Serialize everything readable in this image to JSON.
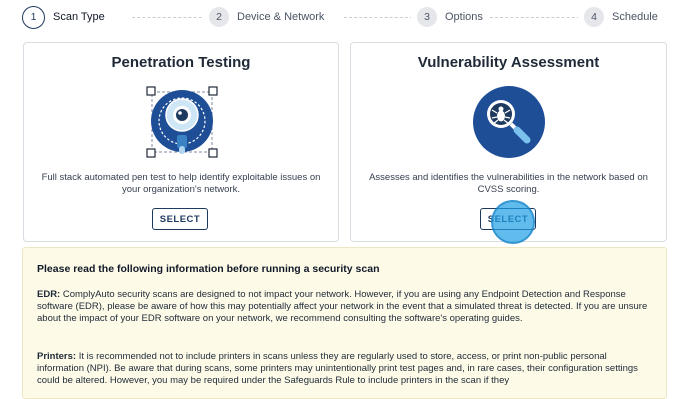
{
  "stepper": {
    "steps": [
      {
        "number": "1",
        "label": "Scan Type",
        "active": true
      },
      {
        "number": "2",
        "label": "Device & Network",
        "active": false
      },
      {
        "number": "3",
        "label": "Options",
        "active": false
      },
      {
        "number": "4",
        "label": "Schedule",
        "active": false
      }
    ]
  },
  "cards": [
    {
      "title": "Penetration Testing",
      "description": "Full stack automated pen test to help identify exploitable issues on your organization's network.",
      "button_label": "SELECT",
      "icon": "eye-scan-icon"
    },
    {
      "title": "Vulnerability Assessment",
      "description": "Assesses and identifies the vulnerabilities in the network based on CVSS scoring.",
      "button_label": "SELECT",
      "icon": "bug-magnifier-icon"
    }
  ],
  "notice": {
    "heading": "Please read the following information before running a security scan",
    "edr_label": "EDR:",
    "edr_text": "ComplyAuto security scans are designed to not impact your network. However, if you are using any Endpoint Detection and Response software (EDR), please be aware of how this may potentially affect your network in the event that a simulated threat is detected. If you are unsure about the impact of your EDR software on your network, we recommend consulting the software's operating guides.",
    "printers_label": "Printers:",
    "printers_text": "It is recommended not to include printers in scans unless they are regularly used to store, access, or print non-public personal information (NPI). Be aware that during scans, some printers may unintentionally print test pages and, in rare cases, their configuration settings could be altered. However, you may be required under the Safeguards Rule to include printers in the scan if they"
  },
  "colors": {
    "accent": "#1e3a5f",
    "icon_blue": "#1d4e96",
    "notice_bg": "#fdfbe8",
    "cursor": "#1ea0e6"
  }
}
